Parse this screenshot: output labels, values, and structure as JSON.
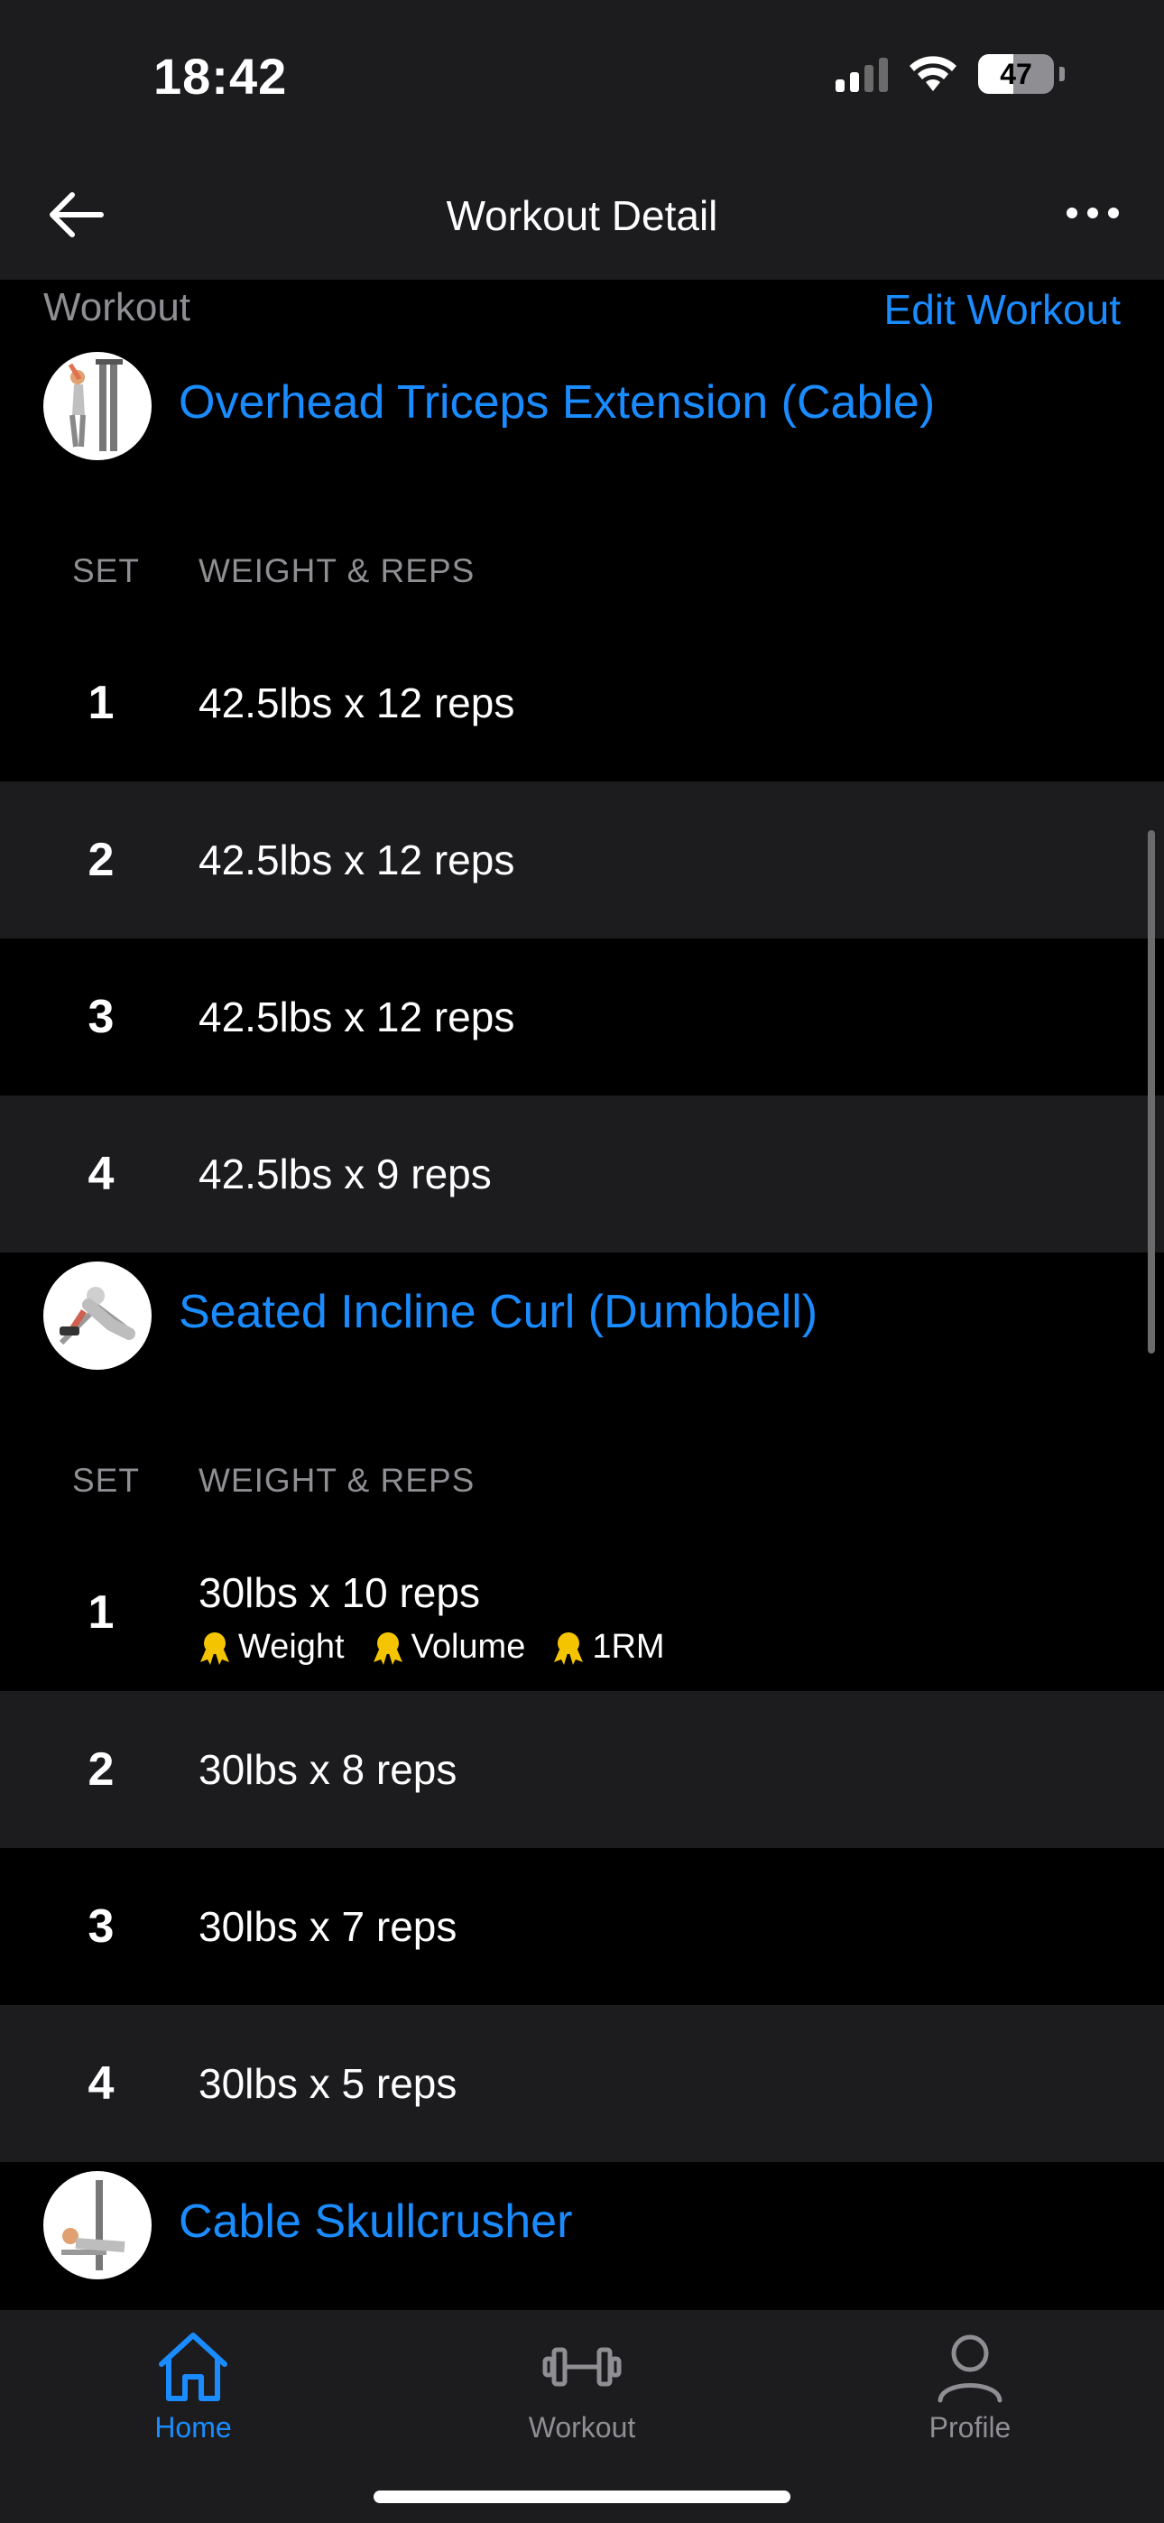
{
  "status_bar": {
    "time": "18:42",
    "battery": "47",
    "battery_level": 0.47
  },
  "nav": {
    "title": "Workout Detail",
    "back_icon": "arrow-left-icon",
    "more_icon": "ellipsis-icon"
  },
  "section": {
    "label": "Workout",
    "edit_label": "Edit Workout"
  },
  "columns": {
    "set": "SET",
    "weight_reps": "WEIGHT & REPS"
  },
  "exercises": [
    {
      "name": "Overhead Triceps Extension (Cable)",
      "sets": [
        {
          "num": "1",
          "text": "42.5lbs x 12 reps"
        },
        {
          "num": "2",
          "text": "42.5lbs x 12 reps"
        },
        {
          "num": "3",
          "text": "42.5lbs x 12 reps"
        },
        {
          "num": "4",
          "text": "42.5lbs x 9 reps"
        }
      ]
    },
    {
      "name": "Seated Incline Curl (Dumbbell)",
      "sets": [
        {
          "num": "1",
          "text": "30lbs x 10 reps",
          "prs": [
            "Weight",
            "Volume",
            "1RM"
          ]
        },
        {
          "num": "2",
          "text": "30lbs x 8 reps"
        },
        {
          "num": "3",
          "text": "30lbs x 7 reps"
        },
        {
          "num": "4",
          "text": "30lbs x 5 reps"
        }
      ]
    },
    {
      "name": "Cable Skullcrusher"
    }
  ],
  "tabs": [
    {
      "label": "Home",
      "icon": "home-icon",
      "active": true
    },
    {
      "label": "Workout",
      "icon": "dumbbell-icon",
      "active": false
    },
    {
      "label": "Profile",
      "icon": "person-icon",
      "active": false
    }
  ],
  "colors": {
    "accent": "#1a8cff",
    "background": "#000000",
    "surface": "#1c1c1e",
    "medal": "#f5c400"
  }
}
